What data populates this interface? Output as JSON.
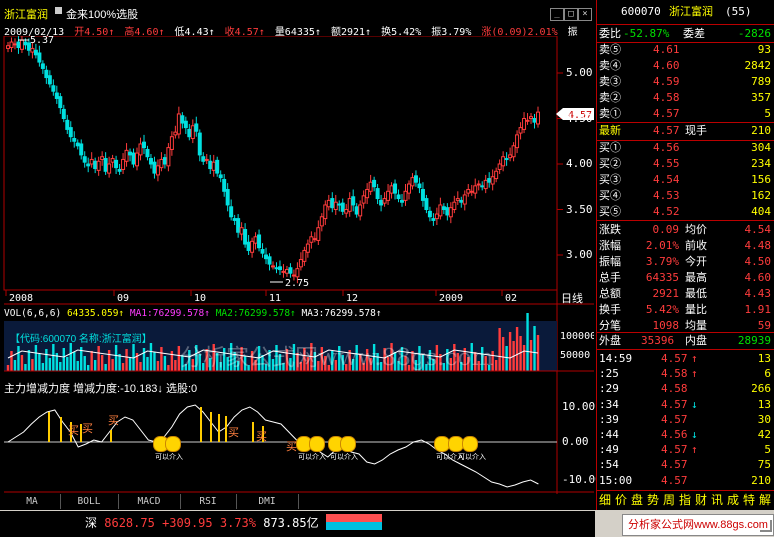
{
  "window": {
    "stock_name": "浙江富润",
    "formula_name": "金来100%选股",
    "minimize_label": "_",
    "restore_label": "□",
    "close_label": "×"
  },
  "info_bar": {
    "date": "2009/02/13",
    "open": "开4.50↑",
    "high": "高4.60↑",
    "low": "低4.43↑",
    "close": "收4.57↑",
    "volume": "量64335↑",
    "amount": "额2921↑",
    "turnover": "换5.42%",
    "amplitude": "振3.79%",
    "change": "涨(0.09)2.01%",
    "extra": "振"
  },
  "price_chart": {
    "max_marker": "5.37",
    "min_marker": "2.75",
    "current_price_tag": "4.57",
    "y_ticks": [
      "5.00",
      "4.50",
      "4.00",
      "3.50",
      "3.00"
    ],
    "x_ticks": [
      "2008",
      "09",
      "10",
      "11",
      "12",
      "2009",
      "02"
    ],
    "period_label": "日线",
    "colors": {
      "up": "#ff3c3c",
      "down": "#00e0e0",
      "axis": "#b00000"
    }
  },
  "volume_panel": {
    "label": "VOL(6,6,6)",
    "vol_value": "64335.059↑",
    "ma1": "MA1:76299.578↑",
    "ma2": "MA2:76299.578↑",
    "ma3": "MA3:76299.578↑",
    "banner": "【代码:600070  名称:浙江富润】",
    "y_ticks": [
      "100000",
      "50000"
    ]
  },
  "watermark_text": "分析家公式网www.88gs.com",
  "indicator_panel": {
    "title": "主力增减力度",
    "value": "增减力度:-10.183↓",
    "signal": "选股:0",
    "y_ticks": [
      "10.00",
      "0.00",
      "-10.00"
    ],
    "buy_marks": [
      "买",
      "买",
      "买",
      "买",
      "买",
      "买"
    ],
    "smiley_label": "可以介入"
  },
  "bottom_tabs": [
    "MA",
    "BOLL",
    "MACD",
    "RSI",
    "DMI"
  ],
  "quote_panel": {
    "code": "600070",
    "name": "浙江富润",
    "number": "(55)",
    "weibi_label": "委比",
    "weibi_value": "-52.87%",
    "weicha_label": "委差",
    "weicha_value": "-2826",
    "sell": [
      {
        "label": "卖⑤",
        "price": "4.61",
        "vol": "93"
      },
      {
        "label": "卖④",
        "price": "4.60",
        "vol": "2842"
      },
      {
        "label": "卖③",
        "price": "4.59",
        "vol": "789"
      },
      {
        "label": "卖②",
        "price": "4.58",
        "vol": "357"
      },
      {
        "label": "卖①",
        "price": "4.57",
        "vol": "5"
      }
    ],
    "latest_label": "最新",
    "latest_price": "4.57",
    "xianshou_label": "现手",
    "xianshou_value": "210",
    "buy": [
      {
        "label": "买①",
        "price": "4.56",
        "vol": "304"
      },
      {
        "label": "买②",
        "price": "4.55",
        "vol": "234"
      },
      {
        "label": "买③",
        "price": "4.54",
        "vol": "156"
      },
      {
        "label": "买④",
        "price": "4.53",
        "vol": "162"
      },
      {
        "label": "买⑤",
        "price": "4.52",
        "vol": "404"
      }
    ],
    "stats": [
      {
        "l1": "涨跌",
        "v1": "0.09",
        "l2": "均价",
        "v2": "4.54"
      },
      {
        "l1": "涨幅",
        "v1": "2.01%",
        "l2": "前收",
        "v2": "4.48"
      },
      {
        "l1": "振幅",
        "v1": "3.79%",
        "l2": "今开",
        "v2": "4.50"
      },
      {
        "l1": "总手",
        "v1": "64335",
        "l2": "最高",
        "v2": "4.60"
      },
      {
        "l1": "总额",
        "v1": "2921",
        "l2": "最低",
        "v2": "4.43"
      },
      {
        "l1": "换手",
        "v1": "5.42%",
        "l2": "量比",
        "v2": "1.91"
      },
      {
        "l1": "分笔",
        "v1": "1098",
        "l2": "均量",
        "v2": "59"
      }
    ],
    "waipan_label": "外盘",
    "waipan_value": "35396",
    "neipan_label": "内盘",
    "neipan_value": "28939",
    "ticks": [
      {
        "time": "14:59",
        "price": "4.57",
        "arrow": "↑",
        "vol": "13"
      },
      {
        "time": ":25",
        "price": "4.58",
        "arrow": "↑",
        "vol": "6"
      },
      {
        "time": ":29",
        "price": "4.58",
        "arrow": "",
        "vol": "266"
      },
      {
        "time": ":34",
        "price": "4.57",
        "arrow": "↓",
        "vol": "13"
      },
      {
        "time": ":39",
        "price": "4.57",
        "arrow": "",
        "vol": "30"
      },
      {
        "time": ":44",
        "price": "4.56",
        "arrow": "↓",
        "vol": "42"
      },
      {
        "time": ":49",
        "price": "4.57",
        "arrow": "↑",
        "vol": "5"
      },
      {
        "time": ":54",
        "price": "4.57",
        "arrow": "",
        "vol": "75"
      },
      {
        "time": "15:00",
        "price": "4.57",
        "arrow": "",
        "vol": "210"
      }
    ],
    "tabs": [
      "细",
      "价",
      "盘",
      "势",
      "周",
      "指",
      "财",
      "讯",
      "成",
      "特",
      "解"
    ]
  },
  "status_bar": {
    "market": "深",
    "index_value": "8628.75",
    "change": "+309.95",
    "pct": "3.73%",
    "amount": "873.85亿",
    "site": "分析家公式网www.88gs.com"
  }
}
